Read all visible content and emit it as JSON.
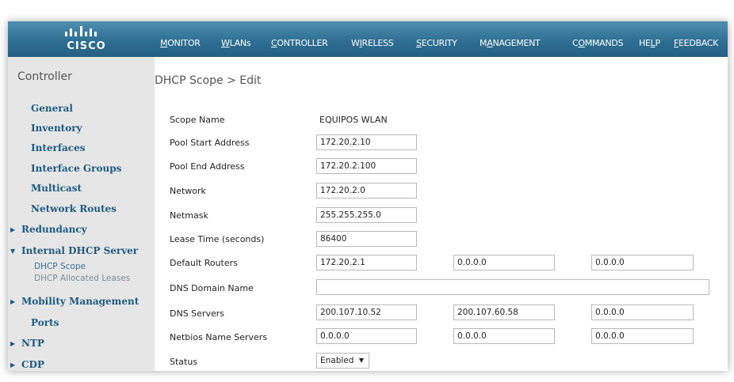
{
  "header": {
    "logo_text": "CISCO",
    "menu": [
      {
        "id": "monitor",
        "pre": "",
        "u": "M",
        "post": "ONITOR"
      },
      {
        "id": "wlans",
        "pre": "",
        "u": "W",
        "post": "LANs"
      },
      {
        "id": "controller",
        "pre": "",
        "u": "C",
        "post": "ONTROLLER"
      },
      {
        "id": "wireless",
        "pre": "W",
        "u": "I",
        "post": "RELESS"
      },
      {
        "id": "security",
        "pre": "",
        "u": "S",
        "post": "ECURITY"
      },
      {
        "id": "management",
        "pre": "M",
        "u": "A",
        "post": "NAGEMENT"
      },
      {
        "id": "commands",
        "pre": "C",
        "u": "O",
        "post": "MMANDS"
      },
      {
        "id": "help",
        "pre": "HE",
        "u": "L",
        "post": "P"
      },
      {
        "id": "feedback",
        "pre": "",
        "u": "F",
        "post": "EEDBACK"
      }
    ]
  },
  "sidebar": {
    "title": "Controller",
    "items": [
      {
        "label": "General"
      },
      {
        "label": "Inventory"
      },
      {
        "label": "Interfaces"
      },
      {
        "label": "Interface Groups"
      },
      {
        "label": "Multicast"
      },
      {
        "label": "Network Routes"
      },
      {
        "label": "Redundancy"
      },
      {
        "label": "Internal DHCP Server"
      },
      {
        "label": "Mobility Management"
      },
      {
        "label": "Ports"
      },
      {
        "label": "NTP"
      },
      {
        "label": "CDP"
      }
    ],
    "subitems": [
      {
        "label": "DHCP Scope"
      },
      {
        "label": "DHCP Allocated Leases"
      }
    ]
  },
  "main": {
    "title": "DHCP Scope > Edit",
    "fields": {
      "scope_name": {
        "label": "Scope Name",
        "value": "EQUIPOS WLAN"
      },
      "pool_start": {
        "label": "Pool Start Address",
        "value": "172.20.2.10"
      },
      "pool_end": {
        "label": "Pool End Address",
        "value": "172.20.2.100"
      },
      "network": {
        "label": "Network",
        "value": "172.20.2.0"
      },
      "netmask": {
        "label": "Netmask",
        "value": "255.255.255.0"
      },
      "lease_time": {
        "label": "Lease Time (seconds)",
        "value": "86400"
      },
      "default_routers": {
        "label": "Default Routers",
        "values": [
          "172.20.2.1",
          "0.0.0.0",
          "0.0.0.0"
        ]
      },
      "dns_domain": {
        "label": "DNS Domain Name",
        "value": ""
      },
      "dns_servers": {
        "label": "DNS Servers",
        "values": [
          "200.107.10.52",
          "200.107.60.58",
          "0.0.0.0"
        ]
      },
      "netbios": {
        "label": "Netbios Name Servers",
        "values": [
          "0.0.0.0",
          "0.0.0.0",
          "0.0.0.0"
        ]
      },
      "status": {
        "label": "Status",
        "value": "Enabled"
      }
    }
  }
}
